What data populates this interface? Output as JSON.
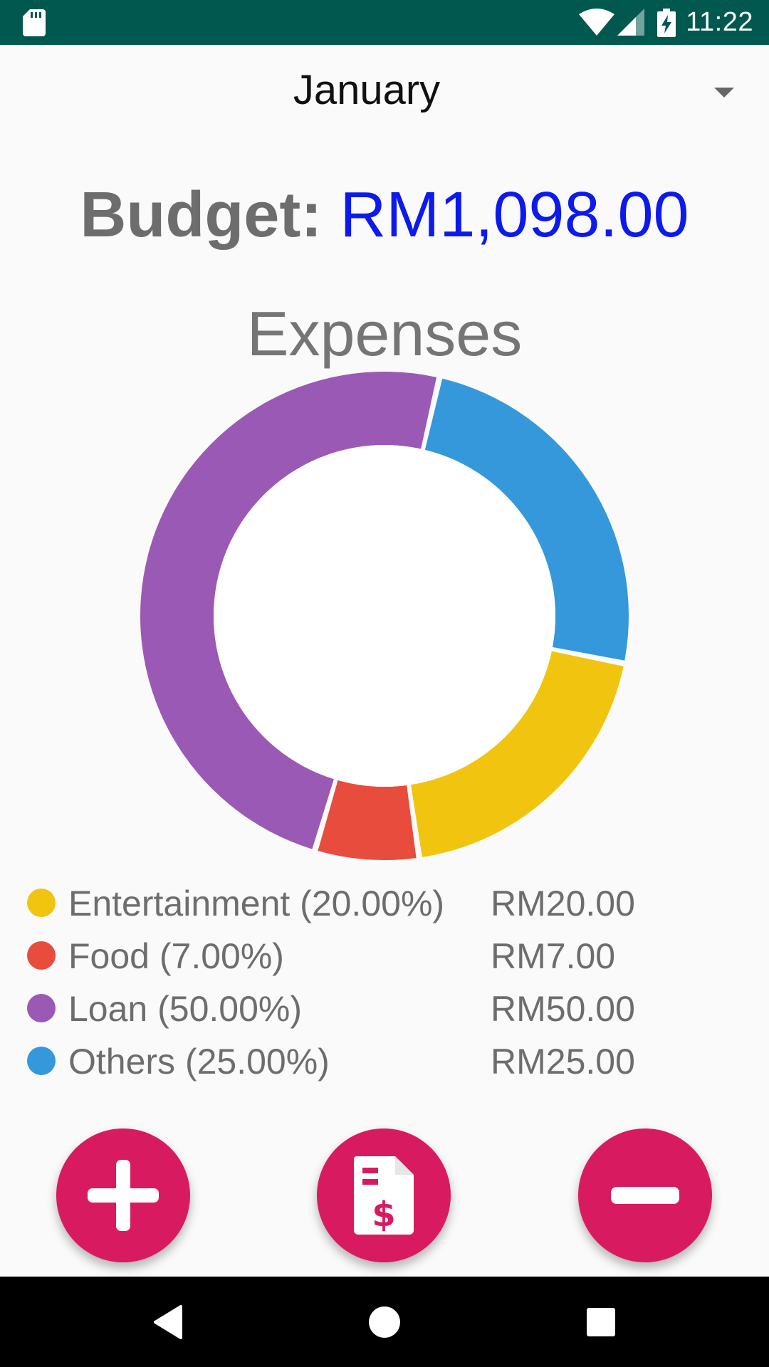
{
  "status_bar": {
    "time": "11:22",
    "background": "#00584e",
    "icons": [
      "sd-card-icon",
      "wifi-icon",
      "cell-signal-icon",
      "battery-charging-icon"
    ]
  },
  "month_selector": {
    "selected": "January",
    "icon": "dropdown-arrow-icon"
  },
  "budget": {
    "label": "Budget:",
    "value": "RM1,098.00",
    "value_color": "#0d1aec"
  },
  "expenses_title": "Expenses",
  "chart_data": {
    "type": "pie",
    "variant": "donut",
    "title": "Expenses",
    "legend_position": "bottom-left",
    "series": [
      {
        "name": "Entertainment",
        "value": 20,
        "percent": "20.00%",
        "amount": "RM20.00",
        "color": "#f1c40f"
      },
      {
        "name": "Food",
        "value": 7,
        "percent": "7.00%",
        "amount": "RM7.00",
        "color": "#e74c3c"
      },
      {
        "name": "Loan",
        "value": 50,
        "percent": "50.00%",
        "amount": "RM50.00",
        "color": "#9b59b6"
      },
      {
        "name": "Others",
        "value": 25,
        "percent": "25.00%",
        "amount": "RM25.00",
        "color": "#3498db"
      }
    ]
  },
  "legend": [
    {
      "label": "Entertainment (20.00%)",
      "amount": "RM20.00"
    },
    {
      "label": "Food (7.00%)",
      "amount": "RM7.00"
    },
    {
      "label": "Loan (50.00%)",
      "amount": "RM50.00"
    },
    {
      "label": "Others (25.00%)",
      "amount": "RM25.00"
    }
  ],
  "actions": {
    "accent_color": "#d81b60",
    "add_icon": "plus-icon",
    "report_icon": "invoice-dollar-icon",
    "remove_icon": "minus-icon"
  },
  "nav_bar": {
    "icons": [
      "back-icon",
      "home-icon",
      "recents-icon"
    ]
  }
}
